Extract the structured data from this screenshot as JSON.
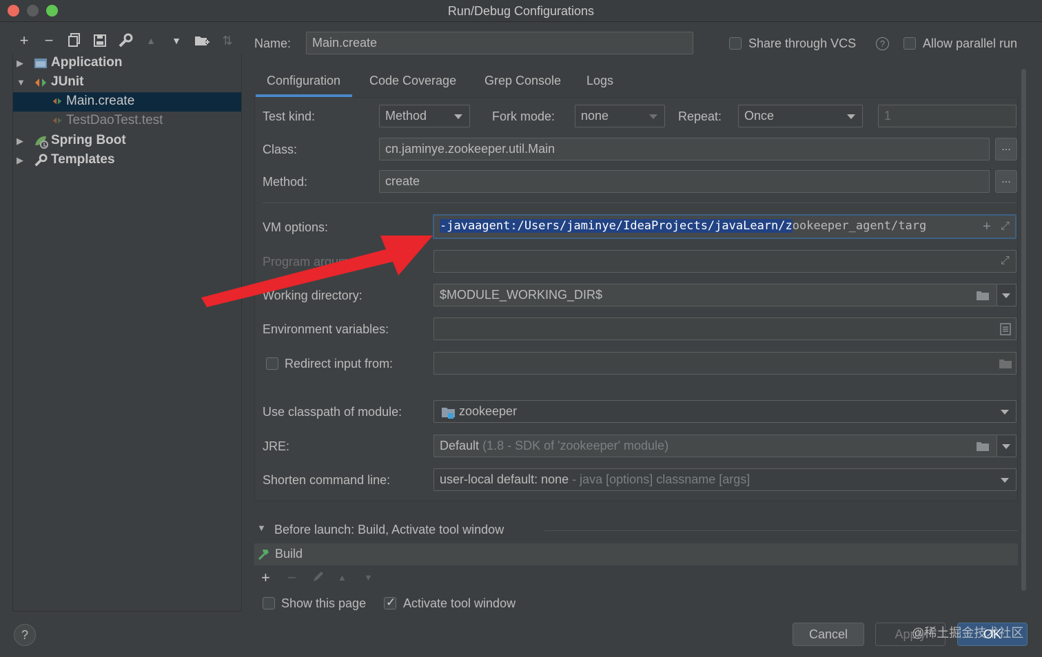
{
  "window": {
    "title": "Run/Debug Configurations"
  },
  "tree": {
    "items": [
      {
        "label": "Application",
        "icon": "application-icon"
      },
      {
        "label": "JUnit",
        "icon": "junit-icon"
      },
      {
        "label": "Main.create",
        "icon": "junit-config-icon"
      },
      {
        "label": "TestDaoTest.test",
        "icon": "junit-config-icon"
      },
      {
        "label": "Spring Boot",
        "icon": "spring-boot-icon"
      },
      {
        "label": "Templates",
        "icon": "wrench-icon"
      }
    ]
  },
  "header": {
    "name_label": "Name:",
    "name_value": "Main.create",
    "share_vcs_label": "Share through VCS",
    "allow_parallel_label": "Allow parallel run"
  },
  "tabs": [
    {
      "label": "Configuration"
    },
    {
      "label": "Code Coverage"
    },
    {
      "label": "Grep Console"
    },
    {
      "label": "Logs"
    }
  ],
  "form": {
    "test_kind_label": "Test kind:",
    "test_kind_value": "Method",
    "fork_mode_label": "Fork mode:",
    "fork_mode_value": "none",
    "repeat_label": "Repeat:",
    "repeat_value": "Once",
    "repeat_count": "1",
    "class_label": "Class:",
    "class_value": "cn.jaminye.zookeeper.util.Main",
    "method_label": "Method:",
    "method_value": "create",
    "dots": "...",
    "vm_options_label": "VM options:",
    "vm_options_selected": "-javaagent:/Users/jaminye/IdeaProjects/javaLearn/z",
    "vm_options_rest": "ookeeper_agent/targ",
    "program_args_label": "Program arguments:",
    "working_dir_label": "Working directory:",
    "working_dir_value": "$MODULE_WORKING_DIR$",
    "env_vars_label": "Environment variables:",
    "redirect_label": "Redirect input from:",
    "classpath_label": "Use classpath of module:",
    "classpath_value": "zookeeper",
    "jre_label": "JRE:",
    "jre_value": "Default",
    "jre_detail": "(1.8 - SDK of 'zookeeper' module)",
    "shorten_label": "Shorten command line:",
    "shorten_value": "user-local default: none",
    "shorten_detail": "- java [options] classname [args]"
  },
  "before_launch": {
    "title": "Before launch: Build, Activate tool window",
    "item": "Build",
    "show_page_label": "Show this page",
    "activate_label": "Activate tool window"
  },
  "buttons": {
    "cancel": "Cancel",
    "apply": "Apply",
    "ok": "OK",
    "help": "?"
  },
  "watermark": "@稀土掘金技术社区",
  "colors": {
    "background": "#3c3f41",
    "selection": "#214283",
    "accent": "#4a88c7",
    "arrow": "#e8262b"
  }
}
